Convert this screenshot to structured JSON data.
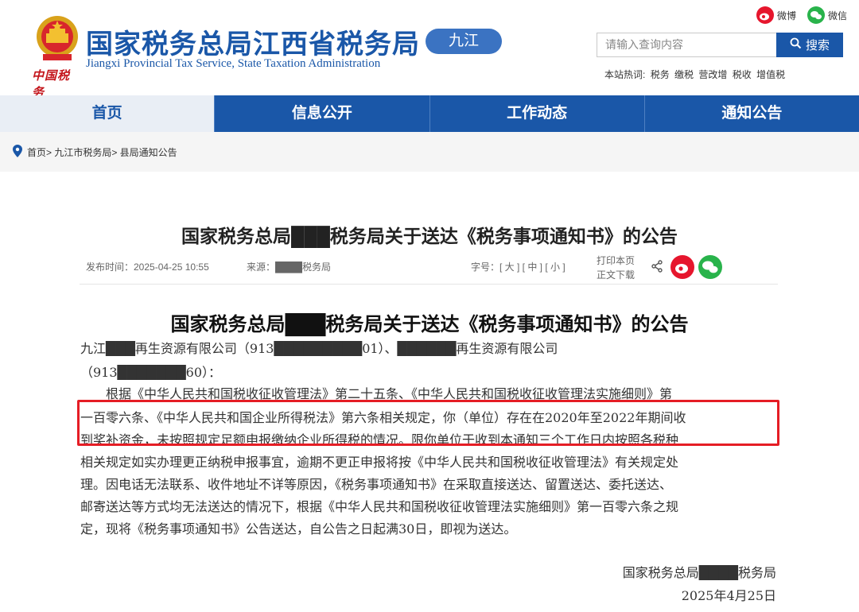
{
  "header": {
    "site_title": "国家税务总局江西省税务局",
    "site_subtitle": "Jiangxi Provincial Tax Service, State Taxation Administration",
    "city_tag": "九江",
    "china_tax": "中国税务",
    "share_weibo": "微博",
    "share_wechat": "微信",
    "search_placeholder": "请输入查询内容",
    "search_button": "搜索",
    "hot_label": "本站热词:",
    "hot_words": [
      "税务",
      "缴税",
      "营改增",
      "税收",
      "增值税"
    ]
  },
  "nav": [
    "首页",
    "信息公开",
    "工作动态",
    "通知公告"
  ],
  "breadcrumb": "首页> 九江市税务局> 县局通知公告",
  "article": {
    "page_title": "国家税务总局███税务局关于送达《税务事项通知书》的公告",
    "publish_time": "发布时间：2025-04-25 10:55",
    "source": "来源：████税务局",
    "font_size": "字号：[ 大 ] [ 中 ] [ 小 ]",
    "print": "打印本页",
    "download": "正文下载",
    "doc_title": "国家税务总局███税务局关于送达《税务事项通知书》的公告",
    "addressee_1": "九江███再生资源有限公司（913█████████01）、██████再生资源有限公司",
    "addressee_2": "（913███████60）：",
    "body_lines": [
      "根据《中华人民共和国税收征收管理法》第二十五条、《中华人民共和国税收征收管理法实施细则》第",
      "一百零六条、《中华人民共和国企业所得税法》第六条相关规定，你（单位）存在在2020年至2022年期间收",
      "到奖补资金，未按照规定足额申报缴纳企业所得税的情况。限你单位于收到本通知三个工作日内按照各税种",
      "相关规定如实办理更正纳税申报事宜，逾期不更正申报将按《中华人民共和国税收征收管理法》有关规定处",
      "理。因电话无法联系、收件地址不详等原因，《税务事项通知书》在采取直接送达、留置送达、委托送达、",
      "邮寄送达等方式均无法送达的情况下，根据《中华人民共和国税收征收管理法实施细则》第一百零六条之规",
      "定，现将《税务事项通知书》公告送达，自公告之日起满30日，即视为送达。"
    ],
    "sign_org": "国家税务总局████税务局",
    "sign_date": "2025年4月25日"
  },
  "colors": {
    "brand_blue": "#1a57a8",
    "highlight_red": "#e51d25",
    "weibo_red": "#e6162d",
    "wechat_green": "#29b34b"
  },
  "icons": [
    "national-emblem-icon",
    "weibo-icon",
    "wechat-icon",
    "search-icon",
    "location-pin-icon",
    "share-icon"
  ]
}
